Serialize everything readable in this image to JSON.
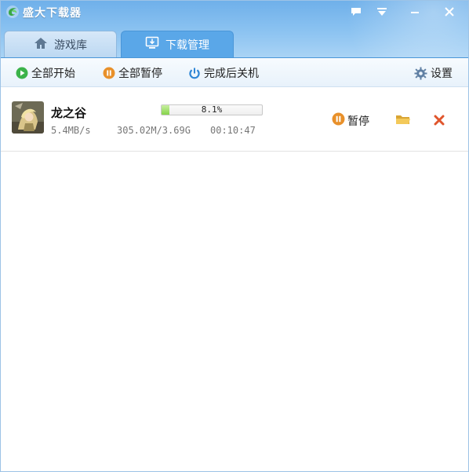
{
  "window": {
    "title": "盛大下载器",
    "controls": [
      "message-icon",
      "menu-icon",
      "minimize-icon",
      "close-icon"
    ]
  },
  "tabs": [
    {
      "label": "游戏库",
      "icon": "home-icon",
      "active": false
    },
    {
      "label": "下载管理",
      "icon": "monitor-download-icon",
      "active": true
    }
  ],
  "toolbar": {
    "start_all": "全部开始",
    "pause_all": "全部暂停",
    "shutdown_after": "完成后关机",
    "settings": "设置"
  },
  "downloads": [
    {
      "name": "龙之谷",
      "progress_text": "8.1%",
      "progress_fraction": 0.081,
      "speed": "5.4MB/s",
      "size": "305.02M/3.69G",
      "time_left": "00:10:47",
      "pause_label": "暂停"
    }
  ],
  "colors": {
    "header": "#7dbaee",
    "active_tab": "#5aa7e8",
    "start_icon": "#3bb34a",
    "pause_icon": "#e8902a",
    "power_icon": "#2f86d6",
    "progress_fill": "#86d34a",
    "delete_icon": "#e0552c",
    "folder_icon": "#e9b944"
  }
}
